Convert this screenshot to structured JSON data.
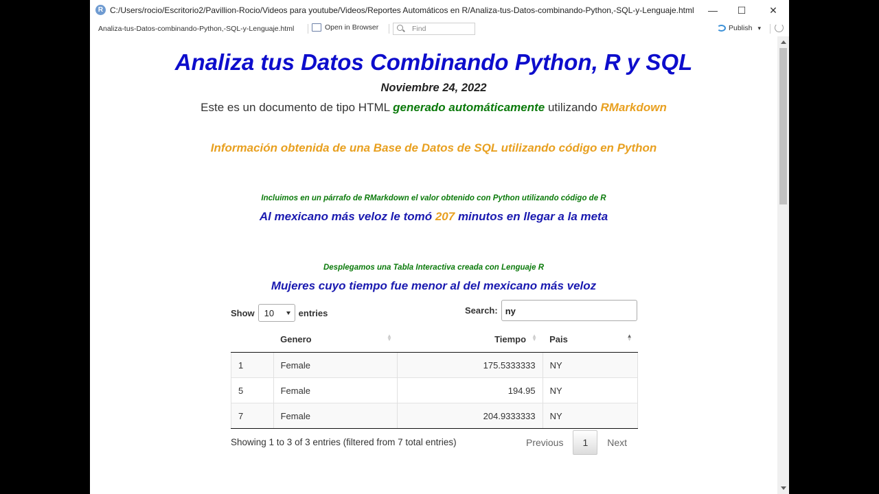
{
  "window": {
    "title": "C:/Users/rocio/Escritorio2/Pavillion-Rocio/Videos para youtube/Videos/Reportes Automáticos en R/Analiza-tus-Datos-combinando-Python,-SQL-y-Lenguaje.html",
    "buttons": {
      "minimize": "—",
      "maximize": "☐",
      "close": "✕"
    }
  },
  "toolbar": {
    "file": "Analiza-tus-Datos-combinando-Python,-SQL-y-Lenguaje.html",
    "open_in_browser": "Open in Browser",
    "find_placeholder": "Find",
    "publish": "Publish",
    "publish_caret": "▾"
  },
  "doc": {
    "title": "Analiza tus Datos Combinando Python, R y SQL",
    "date": "Noviembre 24, 2022",
    "intro_pre": "Este es un documento de tipo HTML ",
    "intro_green": "generado automáticamente",
    "intro_mid": " utilizando ",
    "intro_orange": "RMarkdown",
    "info_heading": "Información obtenida de una Base de Datos de SQL utilizando código en Python",
    "para_note": "Incluimos en un párrafo de RMarkdown el valor obtenido con Python utilizando código de R",
    "fastest_pre": "Al mexicano más veloz le tomó ",
    "fastest_value": "207",
    "fastest_post": " minutos en llegar a la meta",
    "table_note": "Desplegamos una Tabla Interactiva creada con Lenguaje R",
    "table_heading": "Mujeres cuyo tiempo fue menor al del mexicano más veloz"
  },
  "datatable": {
    "show_label": "Show",
    "entries_label": "entries",
    "page_length": "10",
    "search_label": "Search:",
    "search_value": "ny",
    "columns": [
      "",
      "Genero",
      "Tiempo",
      "Pais"
    ],
    "rows": [
      [
        "1",
        "Female",
        "175.5333333",
        "NY"
      ],
      [
        "5",
        "Female",
        "194.95",
        "NY"
      ],
      [
        "7",
        "Female",
        "204.9333333",
        "NY"
      ]
    ],
    "info": "Showing 1 to 3 of 3 entries (filtered from 7 total entries)",
    "prev": "Previous",
    "page": "1",
    "next": "Next"
  }
}
